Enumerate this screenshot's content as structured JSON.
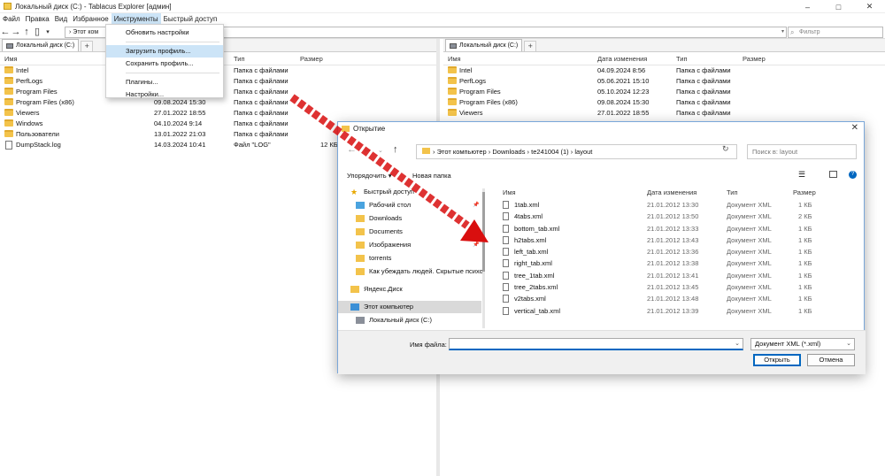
{
  "window": {
    "title": "Локальный диск (C:) - Tablacus Explorer [админ]",
    "controls": [
      "–",
      "□",
      "✕"
    ]
  },
  "menu": [
    "Файл",
    "Правка",
    "Вид",
    "Избранное",
    "Инструменты",
    "Быстрый доступ"
  ],
  "address": {
    "value": "Этот ком",
    "filter_placeholder": "Фильтр"
  },
  "dropdown": {
    "items": [
      "Обновить настройки",
      "Загрузить профиль...",
      "Сохранить профиль...",
      "Плагины...",
      "Настройки..."
    ],
    "highlighted_index": 1
  },
  "left_pane": {
    "tab_label": "Локальный диск (C:)",
    "tab_add": "+",
    "columns": [
      "Имя",
      "Тип",
      "Размер"
    ],
    "rows": [
      {
        "name": "Intel",
        "date": "",
        "type": "Папка с файлами",
        "size": "",
        "kind": "folder"
      },
      {
        "name": "PerfLogs",
        "date": "",
        "type": "Папка с файлами",
        "size": "",
        "kind": "folder"
      },
      {
        "name": "Program Files",
        "date": "",
        "type": "Папка с файлами",
        "size": "",
        "kind": "folder"
      },
      {
        "name": "Program Files (x86)",
        "date": "09.08.2024 15:30",
        "type": "Папка с файлами",
        "size": "",
        "kind": "folder"
      },
      {
        "name": "Viewers",
        "date": "27.01.2022 18:55",
        "type": "Папка с файлами",
        "size": "",
        "kind": "folder"
      },
      {
        "name": "Windows",
        "date": "04.10.2024 9:14",
        "type": "Папка с файлами",
        "size": "",
        "kind": "folder"
      },
      {
        "name": "Пользователи",
        "date": "13.01.2022 21:03",
        "type": "Папка с файлами",
        "size": "",
        "kind": "folder"
      },
      {
        "name": "DumpStack.log",
        "date": "14.03.2024 10:41",
        "type": "Файл \"LOG\"",
        "size": "12 КБ",
        "kind": "file"
      }
    ]
  },
  "right_pane": {
    "tab_label": "Локальный диск (C:)",
    "tab_add": "+",
    "columns": [
      "Имя",
      "Дата изменения",
      "Тип",
      "Размер"
    ],
    "rows": [
      {
        "name": "Intel",
        "date": "04.09.2024 8:56",
        "type": "Папка с файлами"
      },
      {
        "name": "PerfLogs",
        "date": "05.06.2021 15:10",
        "type": "Папка с файлами"
      },
      {
        "name": "Program Files",
        "date": "05.10.2024 12:23",
        "type": "Папка с файлами"
      },
      {
        "name": "Program Files (x86)",
        "date": "09.08.2024 15:30",
        "type": "Папка с файлами"
      },
      {
        "name": "Viewers",
        "date": "27.01.2022 18:55",
        "type": "Папка с файлами"
      }
    ]
  },
  "dialog": {
    "title": "Открытие",
    "close": "✕",
    "path": [
      "Этот компьютер",
      "Downloads",
      "te241004 (1)",
      "layout"
    ],
    "search_placeholder": "Поиск в: layout",
    "organize": "Упорядочить ▾",
    "new_folder": "Новая папка",
    "nav": [
      {
        "label": "Быстрый доступ",
        "indent": 0,
        "icon": "star-icon"
      },
      {
        "label": "Рабочий стол",
        "indent": 1,
        "icon": "desktop-folder-icon",
        "pinned": true
      },
      {
        "label": "Downloads",
        "indent": 1,
        "icon": "folder-icon"
      },
      {
        "label": "Documents",
        "indent": 1,
        "icon": "folder-icon"
      },
      {
        "label": "Изображения",
        "indent": 1,
        "icon": "folder-icon",
        "pinned": true
      },
      {
        "label": "torrents",
        "indent": 1,
        "icon": "folder-icon"
      },
      {
        "label": "Как убеждать людей. Скрытые психо",
        "indent": 1,
        "icon": "folder-icon"
      },
      {
        "label": "Яндекс.Диск",
        "indent": 0,
        "icon": "folder-icon"
      },
      {
        "label": "Этот компьютер",
        "indent": 0,
        "icon": "computer-icon",
        "selected": true
      },
      {
        "label": "Локальный диск (C:)",
        "indent": 1,
        "icon": "drive-icon"
      }
    ],
    "columns": [
      "Имя",
      "Дата изменения",
      "Тип",
      "Размер"
    ],
    "files": [
      {
        "name": "1tab.xml",
        "date": "21.01.2012 13:30",
        "type": "Документ XML",
        "size": "1 КБ"
      },
      {
        "name": "4tabs.xml",
        "date": "21.01.2012 13:50",
        "type": "Документ XML",
        "size": "2 КБ"
      },
      {
        "name": "bottom_tab.xml",
        "date": "21.01.2012 13:33",
        "type": "Документ XML",
        "size": "1 КБ"
      },
      {
        "name": "h2tabs.xml",
        "date": "21.01.2012 13:43",
        "type": "Документ XML",
        "size": "1 КБ"
      },
      {
        "name": "left_tab.xml",
        "date": "21.01.2012 13:36",
        "type": "Документ XML",
        "size": "1 КБ"
      },
      {
        "name": "right_tab.xml",
        "date": "21.01.2012 13:38",
        "type": "Документ XML",
        "size": "1 КБ"
      },
      {
        "name": "tree_1tab.xml",
        "date": "21.01.2012 13:41",
        "type": "Документ XML",
        "size": "1 КБ"
      },
      {
        "name": "tree_2tabs.xml",
        "date": "21.01.2012 13:45",
        "type": "Документ XML",
        "size": "1 КБ"
      },
      {
        "name": "v2tabs.xml",
        "date": "21.01.2012 13:48",
        "type": "Документ XML",
        "size": "1 КБ"
      },
      {
        "name": "vertical_tab.xml",
        "date": "21.01.2012 13:39",
        "type": "Документ XML",
        "size": "1 КБ"
      }
    ],
    "filename_label": "Имя файла:",
    "filename_value": "",
    "filetype": "Документ XML (*.xml)",
    "open_btn": "Открыть",
    "cancel_btn": "Отмена"
  },
  "colors": {
    "accent": "#0067c0",
    "highlight": "#cce4f7",
    "folder": "#f3c34b",
    "arrow": "#d90f0f"
  }
}
